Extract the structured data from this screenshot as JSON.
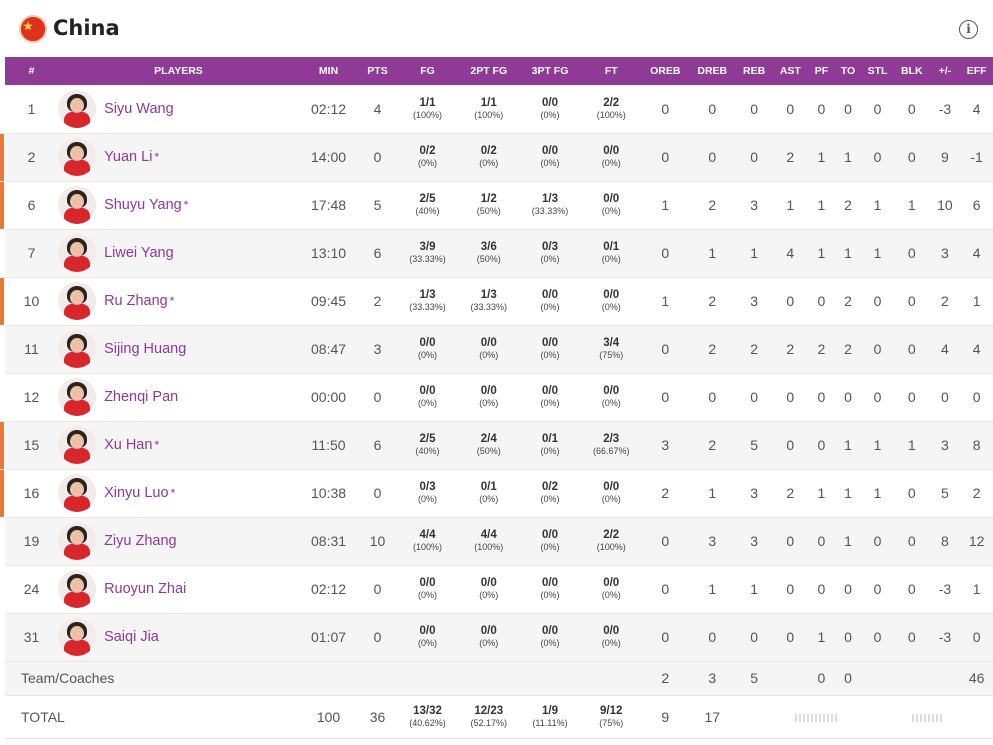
{
  "team": {
    "name": "China"
  },
  "header": {
    "columns": [
      "#",
      "PLAYERS",
      "MIN",
      "PTS",
      "FG",
      "2PT FG",
      "3PT FG",
      "FT",
      "OREB",
      "DREB",
      "REB",
      "AST",
      "PF",
      "TO",
      "STL",
      "BLK",
      "+/-",
      "EFF"
    ]
  },
  "players": [
    {
      "number": "1",
      "name": "Siyu Wang",
      "starter": false,
      "min": "02:12",
      "pts": "4",
      "fg": "1/1",
      "fg_pct": "(100%)",
      "p2": "1/1",
      "p2_pct": "(100%)",
      "p3": "0/0",
      "p3_pct": "(0%)",
      "ft": "2/2",
      "ft_pct": "(100%)",
      "oreb": "0",
      "dreb": "0",
      "reb": "0",
      "ast": "0",
      "pf": "0",
      "to": "0",
      "stl": "0",
      "blk": "0",
      "pm": "-3",
      "eff": "4"
    },
    {
      "number": "2",
      "name": "Yuan Li",
      "starter": true,
      "min": "14:00",
      "pts": "0",
      "fg": "0/2",
      "fg_pct": "(0%)",
      "p2": "0/2",
      "p2_pct": "(0%)",
      "p3": "0/0",
      "p3_pct": "(0%)",
      "ft": "0/0",
      "ft_pct": "(0%)",
      "oreb": "0",
      "dreb": "0",
      "reb": "0",
      "ast": "2",
      "pf": "1",
      "to": "1",
      "stl": "0",
      "blk": "0",
      "pm": "9",
      "eff": "-1"
    },
    {
      "number": "6",
      "name": "Shuyu Yang",
      "starter": true,
      "min": "17:48",
      "pts": "5",
      "fg": "2/5",
      "fg_pct": "(40%)",
      "p2": "1/2",
      "p2_pct": "(50%)",
      "p3": "1/3",
      "p3_pct": "(33.33%)",
      "ft": "0/0",
      "ft_pct": "(0%)",
      "oreb": "1",
      "dreb": "2",
      "reb": "3",
      "ast": "1",
      "pf": "1",
      "to": "2",
      "stl": "1",
      "blk": "1",
      "pm": "10",
      "eff": "6"
    },
    {
      "number": "7",
      "name": "Liwei Yang",
      "starter": false,
      "min": "13:10",
      "pts": "6",
      "fg": "3/9",
      "fg_pct": "(33.33%)",
      "p2": "3/6",
      "p2_pct": "(50%)",
      "p3": "0/3",
      "p3_pct": "(0%)",
      "ft": "0/1",
      "ft_pct": "(0%)",
      "oreb": "0",
      "dreb": "1",
      "reb": "1",
      "ast": "4",
      "pf": "1",
      "to": "1",
      "stl": "1",
      "blk": "0",
      "pm": "3",
      "eff": "4"
    },
    {
      "number": "10",
      "name": "Ru Zhang",
      "starter": true,
      "min": "09:45",
      "pts": "2",
      "fg": "1/3",
      "fg_pct": "(33.33%)",
      "p2": "1/3",
      "p2_pct": "(33.33%)",
      "p3": "0/0",
      "p3_pct": "(0%)",
      "ft": "0/0",
      "ft_pct": "(0%)",
      "oreb": "1",
      "dreb": "2",
      "reb": "3",
      "ast": "0",
      "pf": "0",
      "to": "2",
      "stl": "0",
      "blk": "0",
      "pm": "2",
      "eff": "1"
    },
    {
      "number": "11",
      "name": "Sijing Huang",
      "starter": false,
      "min": "08:47",
      "pts": "3",
      "fg": "0/0",
      "fg_pct": "(0%)",
      "p2": "0/0",
      "p2_pct": "(0%)",
      "p3": "0/0",
      "p3_pct": "(0%)",
      "ft": "3/4",
      "ft_pct": "(75%)",
      "oreb": "0",
      "dreb": "2",
      "reb": "2",
      "ast": "2",
      "pf": "2",
      "to": "2",
      "stl": "0",
      "blk": "0",
      "pm": "4",
      "eff": "4"
    },
    {
      "number": "12",
      "name": "Zhenqi Pan",
      "starter": false,
      "min": "00:00",
      "pts": "0",
      "fg": "0/0",
      "fg_pct": "(0%)",
      "p2": "0/0",
      "p2_pct": "(0%)",
      "p3": "0/0",
      "p3_pct": "(0%)",
      "ft": "0/0",
      "ft_pct": "(0%)",
      "oreb": "0",
      "dreb": "0",
      "reb": "0",
      "ast": "0",
      "pf": "0",
      "to": "0",
      "stl": "0",
      "blk": "0",
      "pm": "0",
      "eff": "0"
    },
    {
      "number": "15",
      "name": "Xu Han",
      "starter": true,
      "min": "11:50",
      "pts": "6",
      "fg": "2/5",
      "fg_pct": "(40%)",
      "p2": "2/4",
      "p2_pct": "(50%)",
      "p3": "0/1",
      "p3_pct": "(0%)",
      "ft": "2/3",
      "ft_pct": "(66.67%)",
      "oreb": "3",
      "dreb": "2",
      "reb": "5",
      "ast": "0",
      "pf": "0",
      "to": "1",
      "stl": "1",
      "blk": "1",
      "pm": "3",
      "eff": "8"
    },
    {
      "number": "16",
      "name": "Xinyu Luo",
      "starter": true,
      "min": "10:38",
      "pts": "0",
      "fg": "0/3",
      "fg_pct": "(0%)",
      "p2": "0/1",
      "p2_pct": "(0%)",
      "p3": "0/2",
      "p3_pct": "(0%)",
      "ft": "0/0",
      "ft_pct": "(0%)",
      "oreb": "2",
      "dreb": "1",
      "reb": "3",
      "ast": "2",
      "pf": "1",
      "to": "1",
      "stl": "1",
      "blk": "0",
      "pm": "5",
      "eff": "2"
    },
    {
      "number": "19",
      "name": "Ziyu Zhang",
      "starter": false,
      "min": "08:31",
      "pts": "10",
      "fg": "4/4",
      "fg_pct": "(100%)",
      "p2": "4/4",
      "p2_pct": "(100%)",
      "p3": "0/0",
      "p3_pct": "(0%)",
      "ft": "2/2",
      "ft_pct": "(100%)",
      "oreb": "0",
      "dreb": "3",
      "reb": "3",
      "ast": "0",
      "pf": "0",
      "to": "1",
      "stl": "0",
      "blk": "0",
      "pm": "8",
      "eff": "12"
    },
    {
      "number": "24",
      "name": "Ruoyun Zhai",
      "starter": false,
      "min": "02:12",
      "pts": "0",
      "fg": "0/0",
      "fg_pct": "(0%)",
      "p2": "0/0",
      "p2_pct": "(0%)",
      "p3": "0/0",
      "p3_pct": "(0%)",
      "ft": "0/0",
      "ft_pct": "(0%)",
      "oreb": "0",
      "dreb": "1",
      "reb": "1",
      "ast": "0",
      "pf": "0",
      "to": "0",
      "stl": "0",
      "blk": "0",
      "pm": "-3",
      "eff": "1"
    },
    {
      "number": "31",
      "name": "Saiqi Jia",
      "starter": false,
      "min": "01:07",
      "pts": "0",
      "fg": "0/0",
      "fg_pct": "(0%)",
      "p2": "0/0",
      "p2_pct": "(0%)",
      "p3": "0/0",
      "p3_pct": "(0%)",
      "ft": "0/0",
      "ft_pct": "(0%)",
      "oreb": "0",
      "dreb": "0",
      "reb": "0",
      "ast": "0",
      "pf": "1",
      "to": "0",
      "stl": "0",
      "blk": "0",
      "pm": "-3",
      "eff": "0"
    }
  ],
  "team_row": {
    "label": "Team/Coaches",
    "oreb": "2",
    "dreb": "3",
    "reb": "5",
    "pf": "0",
    "to": "0",
    "eff": "46"
  },
  "total_row": {
    "label": "TOTAL",
    "min": "100",
    "pts": "36",
    "fg": "13/32",
    "fg_pct": "(40.62%)",
    "p2": "12/23",
    "p2_pct": "(52.17%)",
    "p3": "1/9",
    "p3_pct": "(11.11%)",
    "ft": "9/12",
    "ft_pct": "(75%)",
    "oreb": "9",
    "dreb": "17"
  },
  "colors": {
    "header_bg": "#8e3a96",
    "player_name": "#8e3a96",
    "starter_bar": "#e8793a",
    "flag_red": "#e0301e"
  }
}
